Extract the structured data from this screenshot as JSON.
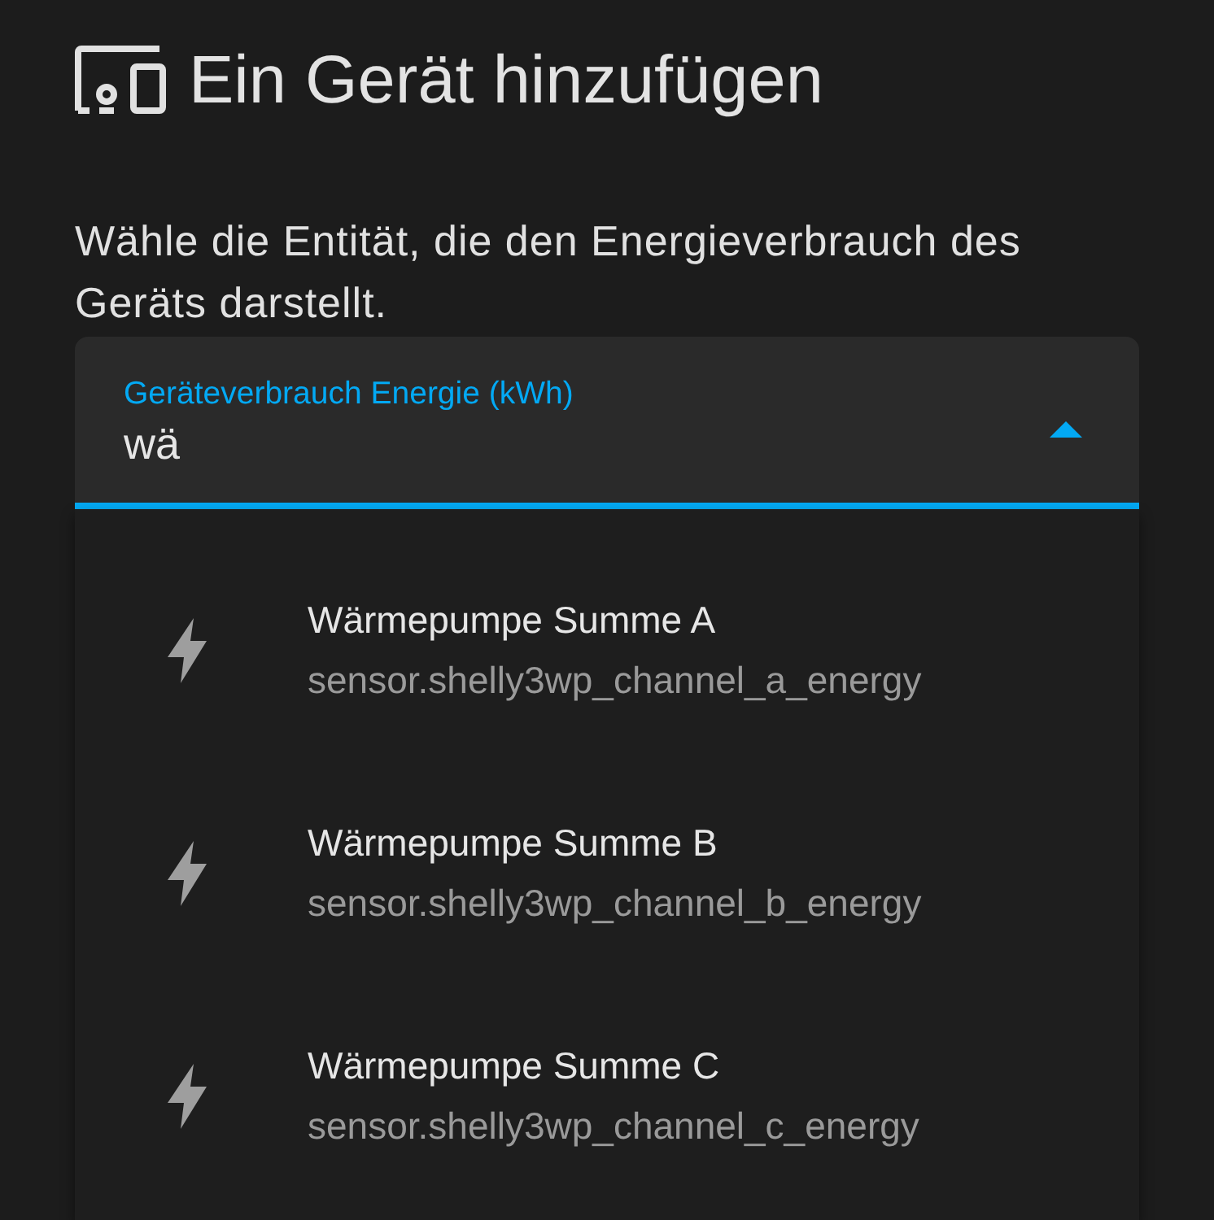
{
  "dialog": {
    "title": "Ein Gerät hinzufügen",
    "description": "Wähle die Entität, die den Energieverbrauch des Geräts darstellt."
  },
  "field": {
    "label": "Geräteverbrauch Energie (kWh)",
    "value": "wä",
    "expanded": true
  },
  "suggestions": [
    {
      "name": "Wärmepumpe Summe A",
      "entity_id": "sensor.shelly3wp_channel_a_energy"
    },
    {
      "name": "Wärmepumpe Summe B",
      "entity_id": "sensor.shelly3wp_channel_b_energy"
    },
    {
      "name": "Wärmepumpe Summe C",
      "entity_id": "sensor.shelly3wp_channel_c_energy"
    }
  ]
}
